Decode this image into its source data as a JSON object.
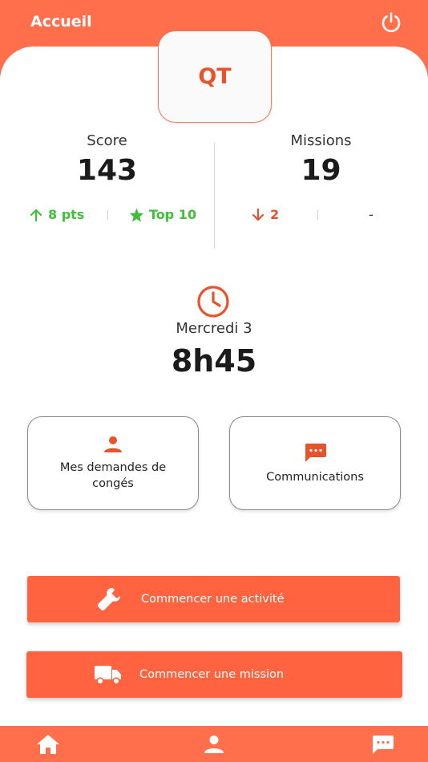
{
  "header": {
    "title": "Accueil",
    "logout_icon": "power-icon"
  },
  "avatar": {
    "initials": "QT"
  },
  "stats": {
    "score": {
      "label": "Score",
      "value": "143",
      "delta": "8 pts",
      "delta_icon": "arrow-up-icon",
      "rank": "Top 10",
      "rank_icon": "star-icon"
    },
    "missions": {
      "label": "Missions",
      "value": "19",
      "delta": "2",
      "delta_icon": "arrow-down-icon",
      "rank": "-"
    }
  },
  "schedule": {
    "icon": "clock-icon",
    "day": "Mercredi 3",
    "time": "8h45"
  },
  "tiles": [
    {
      "label": "Mes demandes de congés",
      "icon": "person-icon"
    },
    {
      "label": "Communications",
      "icon": "message-icon"
    }
  ],
  "actions": [
    {
      "label": "Commencer une activité",
      "icon": "wrench-icon"
    },
    {
      "label": "Commencer une mission",
      "icon": "truck-icon"
    }
  ],
  "bottom_nav": [
    {
      "icon": "home-icon"
    },
    {
      "icon": "person-icon"
    },
    {
      "icon": "message-icon"
    }
  ],
  "colors": {
    "brand": "#ff6f4c",
    "accent": "#e8532c",
    "positive": "#3fbf3a",
    "negative": "#e05230"
  }
}
